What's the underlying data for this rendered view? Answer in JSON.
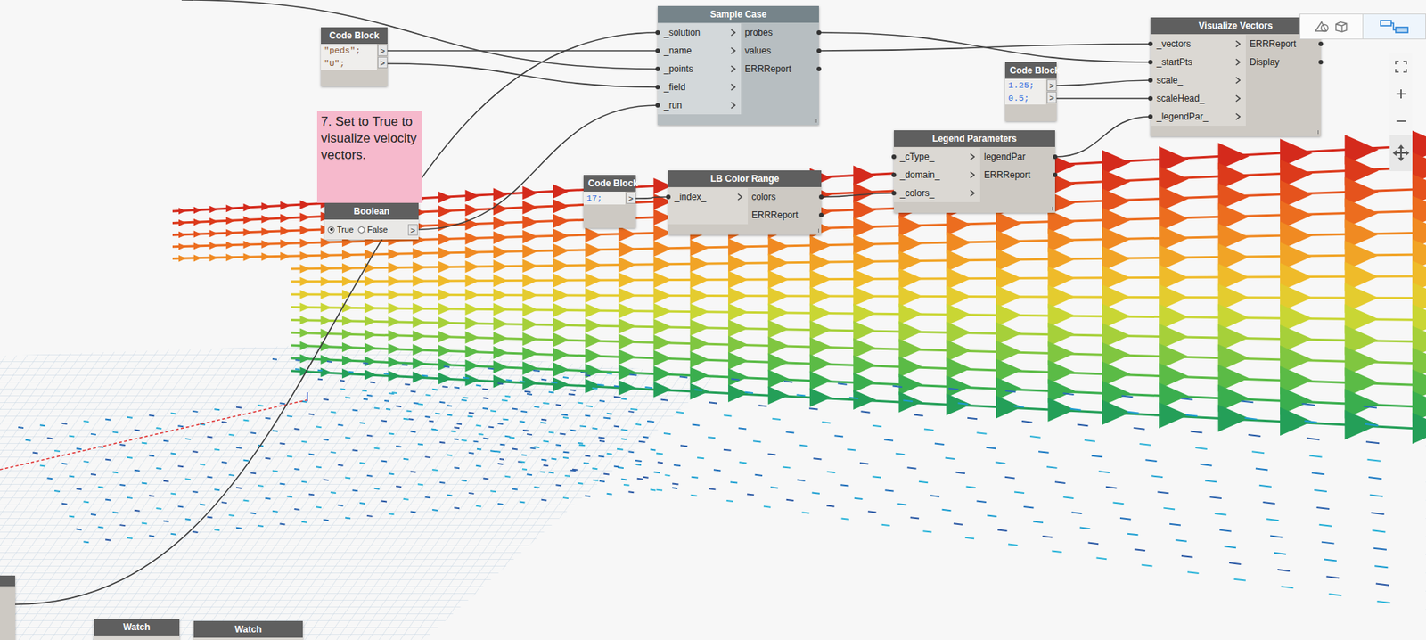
{
  "canvas": {
    "nodes": [
      {
        "kind": "code",
        "title": "Code Block",
        "selected": false,
        "lines": [
          {
            "code": "\"peds\";",
            "kind": "string",
            "port": ">"
          },
          {
            "code": "\"U\";",
            "kind": "string",
            "port": ">"
          }
        ]
      },
      {
        "kind": "component",
        "title": "Sample Case",
        "selected": true,
        "inputs": [
          "_solution",
          "_name",
          "_points",
          "_field",
          "_run"
        ],
        "outputs": [
          "probes",
          "values",
          "ERRReport"
        ]
      },
      {
        "kind": "component",
        "title": "Visualize Vectors",
        "selected": false,
        "inputs": [
          "_vectors",
          "_startPts",
          "scale_",
          "scaleHead_",
          "_legendPar_"
        ],
        "outputs": [
          "ERRReport",
          "Display"
        ]
      },
      {
        "kind": "code",
        "title": "Code Block",
        "selected": false,
        "lines": [
          {
            "code": "1.25;",
            "kind": "number",
            "port": ">"
          },
          {
            "code": "0.5;",
            "kind": "number",
            "port": ">"
          }
        ]
      },
      {
        "kind": "boolean",
        "title": "Boolean",
        "selected": false,
        "options": [
          {
            "label": "True",
            "selected": true
          },
          {
            "label": "False",
            "selected": false
          }
        ],
        "port": ">"
      },
      {
        "kind": "code",
        "title": "Code Block",
        "selected": false,
        "lines": [
          {
            "code": "17;",
            "kind": "number",
            "port": ">"
          }
        ]
      },
      {
        "kind": "component",
        "title": "LB Color Range",
        "selected": false,
        "inputs": [
          "_index_"
        ],
        "outputs": [
          "colors",
          "ERRReport"
        ]
      },
      {
        "kind": "component",
        "title": "Legend Parameters",
        "selected": false,
        "inputs": [
          "_cType_",
          "_domain_",
          "_colors_"
        ],
        "outputs": [
          "legendPar",
          "ERRReport"
        ]
      },
      {
        "kind": "watch",
        "title": "Watch",
        "selected": false
      },
      {
        "kind": "watch",
        "title": "Watch",
        "selected": false
      },
      {
        "kind": "stub",
        "selected": false
      }
    ]
  },
  "note": {
    "text": "7. Set to True to visualize velocity vectors."
  },
  "view_toggle": [
    {
      "selected": false
    },
    {
      "selected": true
    }
  ],
  "vector_field": {
    "wall_rows": [
      "#d42a1c",
      "#dc3a1b",
      "#e5531d",
      "#ec6d1f",
      "#f08a22",
      "#f1a426",
      "#efbb2a",
      "#e4cc2f",
      "#c9d634",
      "#a6d03a",
      "#80c640",
      "#5bbb46",
      "#3aae4e",
      "#249f58"
    ],
    "ground_rows": [
      "#2a6db5",
      "#1e9bd0",
      "#2b5ea8",
      "#33b4d8",
      "#1f7cc4",
      "#2aa7d4",
      "#2c62ad",
      "#27b0d6",
      "#2370ba",
      "#20a0d2",
      "#2d5aa5",
      "#30b6da"
    ]
  }
}
